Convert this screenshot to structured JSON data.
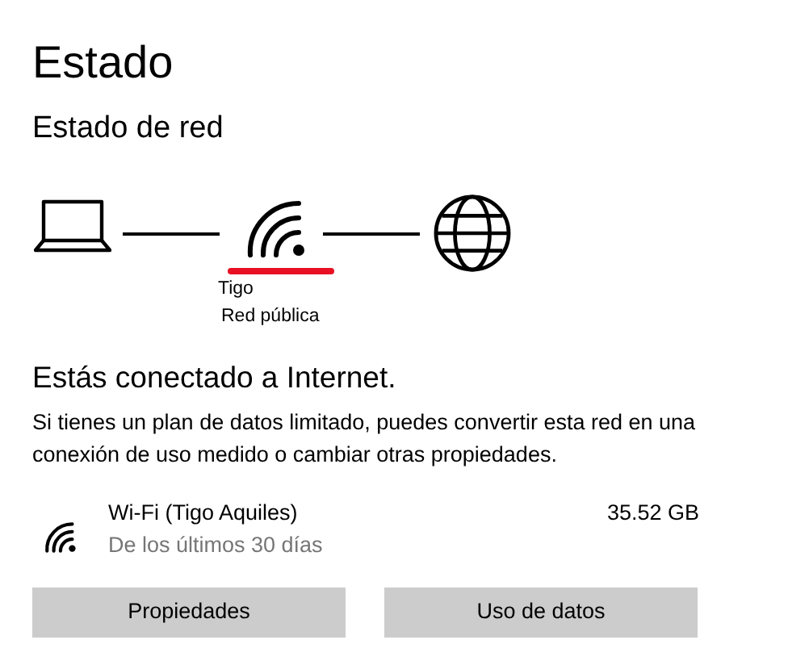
{
  "page_title": "Estado",
  "section_title": "Estado de red",
  "network_diagram": {
    "network_name": "Tigo",
    "network_type": "Red pública"
  },
  "status_heading": "Estás conectado a Internet.",
  "status_description": "Si tienes un plan de datos limitado, puedes convertir esta red en una conexión de uso medido o cambiar otras propiedades.",
  "connection": {
    "name": "Wi-Fi (Tigo Aquiles)",
    "period": "De los últimos 30 días",
    "usage": "35.52 GB"
  },
  "buttons": [
    "Propiedades",
    "Uso de datos"
  ]
}
